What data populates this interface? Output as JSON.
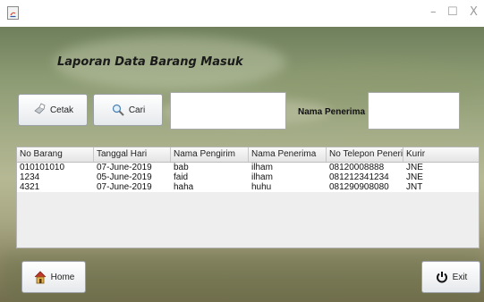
{
  "window": {
    "controls": {
      "minimize": "–",
      "maximize": "☐",
      "close": "X"
    }
  },
  "form": {
    "title": "Laporan Data Barang Masuk",
    "cetak_label": "Cetak",
    "cari_label": "Cari",
    "search_value": "",
    "nama_penerima_label": "Nama Penerima  :",
    "nama_penerima_value": "",
    "home_label": "Home",
    "exit_label": "Exit"
  },
  "table": {
    "columns": [
      "No Barang",
      "Tanggal Hari",
      "Nama Pengirim",
      "Nama Penerima",
      "No Telepon Penerima",
      "Kurir"
    ],
    "rows": [
      [
        "010101010",
        "07-June-2019",
        "bab",
        "ilham",
        "08120008888",
        "JNE"
      ],
      [
        "1234",
        "05-June-2019",
        "faid",
        "ilham",
        "081212341234",
        "JNE"
      ],
      [
        "4321",
        "07-June-2019",
        "haha",
        "huhu",
        "081290908080",
        "JNT"
      ]
    ]
  },
  "icons": {
    "app": "java-app-icon",
    "cetak": "printer-icon",
    "cari": "magnifier-icon",
    "home": "house-icon",
    "exit": "power-icon"
  },
  "colors": {
    "background": "#a3ac86",
    "header_bg": "#e4e4e4",
    "row_bg": "#ffffff",
    "empty_table_bg": "#eeeeee"
  }
}
